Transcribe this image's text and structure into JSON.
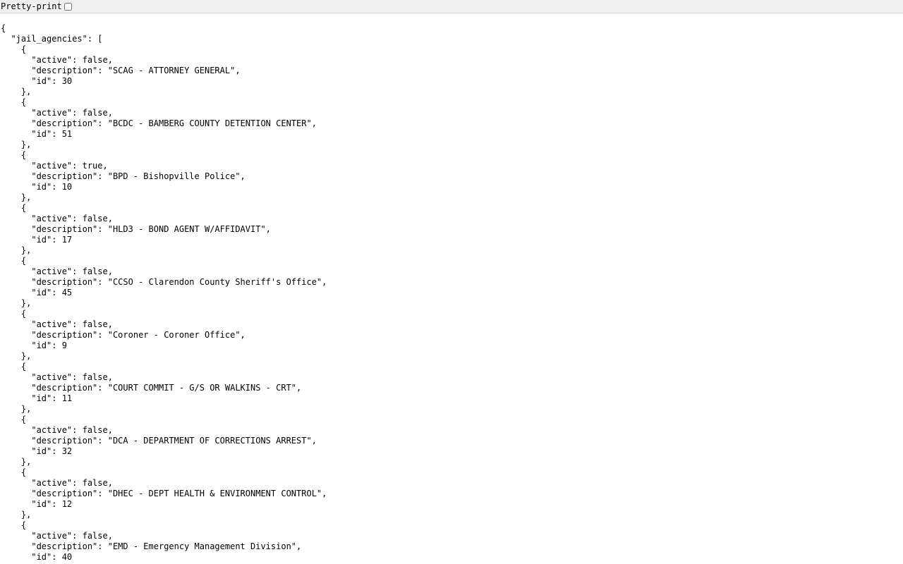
{
  "toolbar": {
    "pretty_print_label": "Pretty-print",
    "pretty_print_checked": false
  },
  "json": {
    "root_key": "jail_agencies",
    "items": [
      {
        "active": "false",
        "description": "SCAG - ATTORNEY GENERAL",
        "id": "30"
      },
      {
        "active": "false",
        "description": "BCDC - BAMBERG COUNTY DETENTION CENTER",
        "id": "51"
      },
      {
        "active": "true",
        "description": "BPD - Bishopville Police",
        "id": "10"
      },
      {
        "active": "false",
        "description": "HLD3 - BOND AGENT W/AFFIDAVIT",
        "id": "17"
      },
      {
        "active": "false",
        "description": "CCSO - Clarendon County Sheriff's Office",
        "id": "45"
      },
      {
        "active": "false",
        "description": "Coroner - Coroner Office",
        "id": "9"
      },
      {
        "active": "false",
        "description": "COURT COMMIT - G/S OR WALKINS - CRT",
        "id": "11"
      },
      {
        "active": "false",
        "description": "DCA - DEPARTMENT OF CORRECTIONS ARREST",
        "id": "32"
      },
      {
        "active": "false",
        "description": "DHEC - DEPT HEALTH & ENVIRONMENT CONTROL",
        "id": "12"
      },
      {
        "active": "false",
        "description": "EMD - Emergency Management Division",
        "id": "40"
      }
    ]
  }
}
